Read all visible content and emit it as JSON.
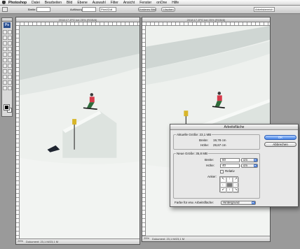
{
  "menubar": {
    "app_name": "Photoshop",
    "items": [
      "Datei",
      "Bearbeiten",
      "Bild",
      "Ebene",
      "Auswahl",
      "Filter",
      "Ansicht",
      "Fenster",
      "onOne",
      "Hilfe"
    ]
  },
  "options_bar": {
    "breite_label": "Breite:",
    "aufloesung_label": "Auflösung:",
    "unit_value": "Pixel/Zoll",
    "vorder_button": "Vorderes Bild",
    "loeschen_button": "Löschen",
    "workspace_value": "Arbeitsbereich"
  },
  "toolbox": {
    "logo": "Ps"
  },
  "documents": [
    {
      "title": "2018.17.JPG bei 25% (RGB/8)",
      "status": "Dokument: 23,1 M/23,1 M",
      "zoom": "25%"
    },
    {
      "title": "2018.17.JPG bei 25% (RGB/8)",
      "status": "Dokument: 23,1 M/23,1 M",
      "zoom": "25%"
    }
  ],
  "dialog": {
    "title": "Arbeitsfläche",
    "current_size": {
      "legend": "Aktuelle Größe: 23,1 MB",
      "width_label": "Breite:",
      "width_value": "19,78 cm",
      "height_label": "Höhe:",
      "height_value": "29,67 cm"
    },
    "new_size": {
      "legend": "Neue Größe: 35,8 MB",
      "width_label": "Breite:",
      "width_value": "60",
      "width_unit": "cm",
      "height_label": "Höhe:",
      "height_value": "40",
      "height_unit": "cm",
      "relative_label": "Relativ",
      "relative_checked": false,
      "anchor_label": "Anker:",
      "anchor_arrows": [
        "↖",
        "↑",
        "↗",
        "←",
        "",
        "→",
        "↙",
        "↓",
        "↘"
      ]
    },
    "bg_label": "Farbe für erw. Arbeitsfläche:",
    "bg_value": "Hintergrund",
    "ok_button": "OK",
    "cancel_button": "Abbrechen"
  },
  "colors": {
    "accent": "#3f7fe6",
    "snow": "#eef1ee",
    "sky": "#cfd6d3",
    "rider_jacket": "#d63a4a",
    "post": "#d8b62a"
  }
}
